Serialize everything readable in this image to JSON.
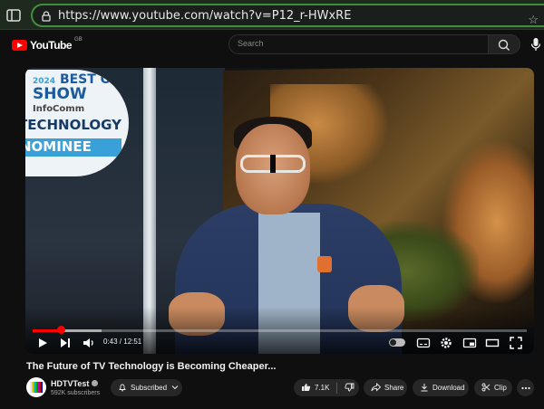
{
  "browser": {
    "url": "https://www.youtube.com/watch?v=P12_r-HWxRE"
  },
  "header": {
    "logo_text": "YouTube",
    "region": "GB",
    "search_placeholder": "Search"
  },
  "video": {
    "sign_line1": "2024",
    "sign_best": "BEST OF",
    "sign_show": "SHOW",
    "sign_infocomm": "InfoComm",
    "sign_technology": "TECHNOLOGY",
    "sign_nominee": "NOMINEE",
    "time_display": "0:43 / 12:51",
    "progress_fraction": 0.056,
    "buffer_fraction": 0.14
  },
  "details": {
    "title": "The Future of TV Technology is Becoming Cheaper...",
    "channel_name": "HDTVTest",
    "subscribers": "592K subscribers",
    "subscribed_label": "Subscribed",
    "likes": "7.1K",
    "share_label": "Share",
    "download_label": "Download",
    "clip_label": "Clip"
  },
  "colors": {
    "accent": "#ff0000",
    "browser_border": "#3f8f3f"
  }
}
